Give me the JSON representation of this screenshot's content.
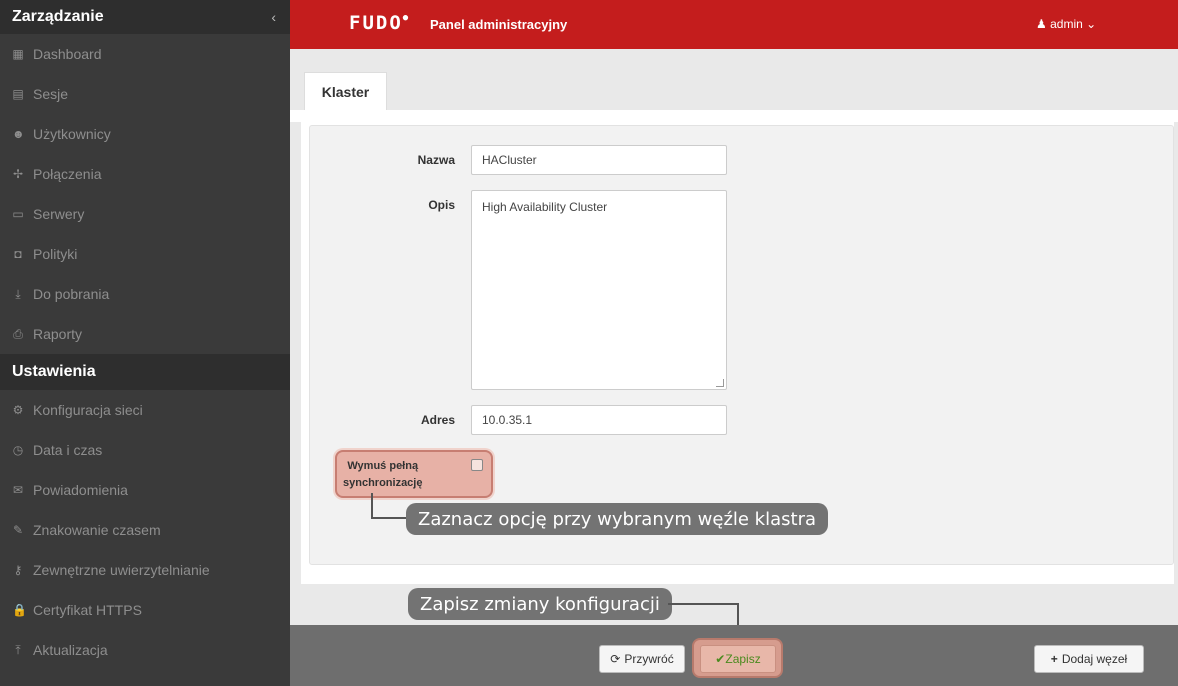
{
  "sidebar": {
    "header": "Zarządzanie",
    "collapse_icon": "‹",
    "items": [
      {
        "label": "Dashboard",
        "icon": "▦"
      },
      {
        "label": "Sesje",
        "icon": "▤"
      },
      {
        "label": "Użytkownicy",
        "icon": "☻"
      },
      {
        "label": "Połączenia",
        "icon": "✢"
      },
      {
        "label": "Serwery",
        "icon": "▭"
      },
      {
        "label": "Polityki",
        "icon": "◘"
      },
      {
        "label": "Do pobrania",
        "icon": "⤓"
      },
      {
        "label": "Raporty",
        "icon": "⎙"
      }
    ],
    "section2": "Ustawienia",
    "items2": [
      {
        "label": "Konfiguracja sieci",
        "icon": "⚙"
      },
      {
        "label": "Data i czas",
        "icon": "◷"
      },
      {
        "label": "Powiadomienia",
        "icon": "✉"
      },
      {
        "label": "Znakowanie czasem",
        "icon": "✎"
      },
      {
        "label": "Zewnętrzne uwierzytelnianie",
        "icon": "⚷"
      },
      {
        "label": "Certyfikat HTTPS",
        "icon": "🔒"
      },
      {
        "label": "Aktualizacja",
        "icon": "⤒"
      }
    ]
  },
  "header": {
    "logo": "FUDO",
    "title": "Panel administracyjny",
    "user": "admin",
    "user_icon": "♟",
    "user_caret": "⌄"
  },
  "tab": "Klaster",
  "form": {
    "name_label": "Nazwa",
    "name_value": "HACluster",
    "desc_label": "Opis",
    "desc_value": "High Availability Cluster",
    "addr_label": "Adres",
    "addr_value": "10.0.35.1",
    "sync_line1": "Wymuś pełną",
    "sync_line2": "synchronizację"
  },
  "callouts": {
    "select_node": "Zaznacz opcję przy wybranym węźle klastra",
    "save_changes": "Zapisz zmiany konfiguracji"
  },
  "buttons": {
    "revert": "Przywróć",
    "save": "Zapisz",
    "add_node": "Dodaj węzeł"
  },
  "colors": {
    "topbar": "#c41d1d",
    "sidebar": "#3a3a3a",
    "highlight": "#e7b1a6"
  }
}
